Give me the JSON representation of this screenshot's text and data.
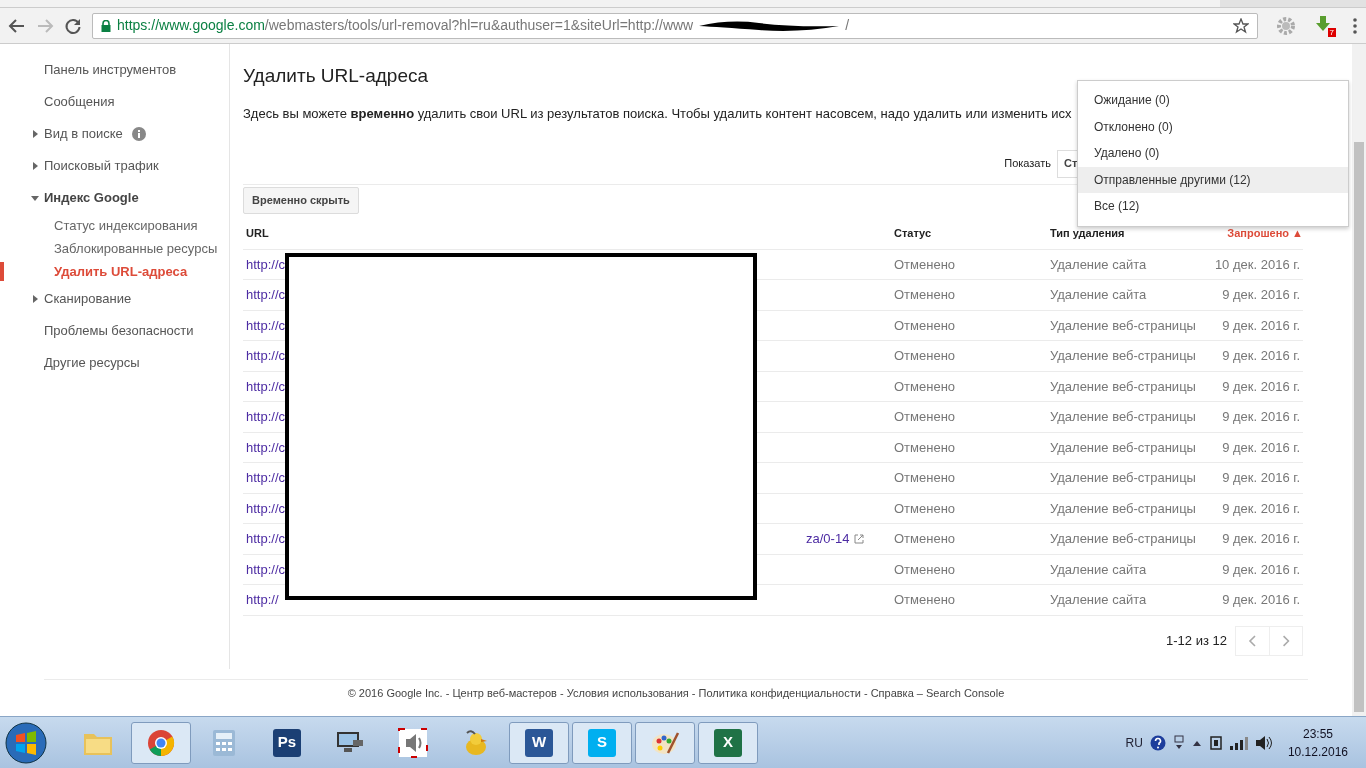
{
  "browser": {
    "url_host": "https://www.google.com",
    "url_path": "/webmasters/tools/url-removal?hl=ru&authuser=1&siteUrl=http://www",
    "url_end": "/",
    "extension_badge": "7"
  },
  "sidebar": {
    "items": [
      {
        "label": "Панель инструментов",
        "kind": "plain",
        "expanded": false
      },
      {
        "label": "Сообщения",
        "kind": "plain",
        "expanded": false
      },
      {
        "label": "Вид в поиске",
        "kind": "group",
        "expanded": false,
        "info": true
      },
      {
        "label": "Поисковый трафик",
        "kind": "group",
        "expanded": false
      },
      {
        "label": "Индекс Google",
        "kind": "group",
        "expanded": true,
        "children": [
          {
            "label": "Статус индексирования",
            "selected": false
          },
          {
            "label": "Заблокированные ресурсы",
            "selected": false
          },
          {
            "label": "Удалить URL-адреса",
            "selected": true
          }
        ]
      },
      {
        "label": "Сканирование",
        "kind": "group",
        "expanded": false
      },
      {
        "label": "Проблемы безопасности",
        "kind": "plain",
        "expanded": false
      },
      {
        "label": "Другие ресурсы",
        "kind": "plain",
        "expanded": false
      }
    ]
  },
  "page": {
    "title": "Удалить URL-адреса",
    "intro": "Здесь вы можете **временно** удалить свои URL из результатов поиска. Чтобы удалить контент насовсем, надо удалить или изменить исх",
    "show_label": "Показать",
    "show_value": "Ст",
    "hide_button": "Временно скрыть"
  },
  "filter_menu": {
    "items": [
      {
        "label": "Ожидание (0)",
        "selected": false
      },
      {
        "label": "Отклонено (0)",
        "selected": false
      },
      {
        "label": "Удалено (0)",
        "selected": false
      },
      {
        "label": "Отправленные другими (12)",
        "selected": true
      },
      {
        "label": "Все (12)",
        "selected": false
      }
    ]
  },
  "table": {
    "columns": [
      "URL",
      "Статус",
      "Тип удаления",
      "Запрошено ▲"
    ],
    "rows": [
      {
        "url": "http://c",
        "url_tail": "",
        "status": "Отменено",
        "type": "Удаление сайта",
        "requested": "10 дек. 2016 г."
      },
      {
        "url": "http://c",
        "url_tail": "",
        "status": "Отменено",
        "type": "Удаление сайта",
        "requested": "9 дек. 2016 г."
      },
      {
        "url": "http://c",
        "url_tail": "",
        "status": "Отменено",
        "type": "Удаление веб-страницы",
        "requested": "9 дек. 2016 г."
      },
      {
        "url": "http://c",
        "url_tail": "",
        "status": "Отменено",
        "type": "Удаление веб-страницы",
        "requested": "9 дек. 2016 г."
      },
      {
        "url": "http://c",
        "url_tail": "",
        "status": "Отменено",
        "type": "Удаление веб-страницы",
        "requested": "9 дек. 2016 г."
      },
      {
        "url": "http://c",
        "url_tail": "",
        "status": "Отменено",
        "type": "Удаление веб-страницы",
        "requested": "9 дек. 2016 г."
      },
      {
        "url": "http://c",
        "url_tail": "",
        "status": "Отменено",
        "type": "Удаление веб-страницы",
        "requested": "9 дек. 2016 г."
      },
      {
        "url": "http://c",
        "url_tail": "",
        "status": "Отменено",
        "type": "Удаление веб-страницы",
        "requested": "9 дек. 2016 г."
      },
      {
        "url": "http://c",
        "url_tail": "",
        "status": "Отменено",
        "type": "Удаление веб-страницы",
        "requested": "9 дек. 2016 г."
      },
      {
        "url": "http://c",
        "url_tail": "za/0-14",
        "status": "Отменено",
        "type": "Удаление веб-страницы",
        "requested": "9 дек. 2016 г."
      },
      {
        "url": "http://c",
        "url_tail": "",
        "status": "Отменено",
        "type": "Удаление сайта",
        "requested": "9 дек. 2016 г."
      },
      {
        "url": "http://",
        "url_tail": "",
        "status": "Отменено",
        "type": "Удаление сайта",
        "requested": "9 дек. 2016 г."
      }
    ]
  },
  "pagination": {
    "range": "1-12 из 12"
  },
  "footer": {
    "text": "© 2016 Google Inc. - Центр веб-мастеров - Условия использования - Политика конфиденциальности - Справка – Search Console"
  },
  "taskbar": {
    "apps": [
      {
        "kind": "folder",
        "active": false
      },
      {
        "kind": "chrome",
        "active": true
      },
      {
        "kind": "calculator",
        "active": false
      },
      {
        "kind": "letter",
        "letter": "Ps",
        "color": "#1b3f74",
        "active": false
      },
      {
        "kind": "monitor",
        "active": false
      },
      {
        "kind": "speaker",
        "active": false
      },
      {
        "kind": "bird",
        "active": false
      },
      {
        "kind": "letter",
        "letter": "W",
        "color": "#2b5797",
        "active": true
      },
      {
        "kind": "letter",
        "letter": "S",
        "color": "#00aff0",
        "active": true
      },
      {
        "kind": "palette",
        "active": true
      },
      {
        "kind": "letter",
        "letter": "X",
        "color": "#1f7246",
        "active": true
      }
    ],
    "language": "RU",
    "time": "23:55",
    "date": "10.12.2016"
  }
}
